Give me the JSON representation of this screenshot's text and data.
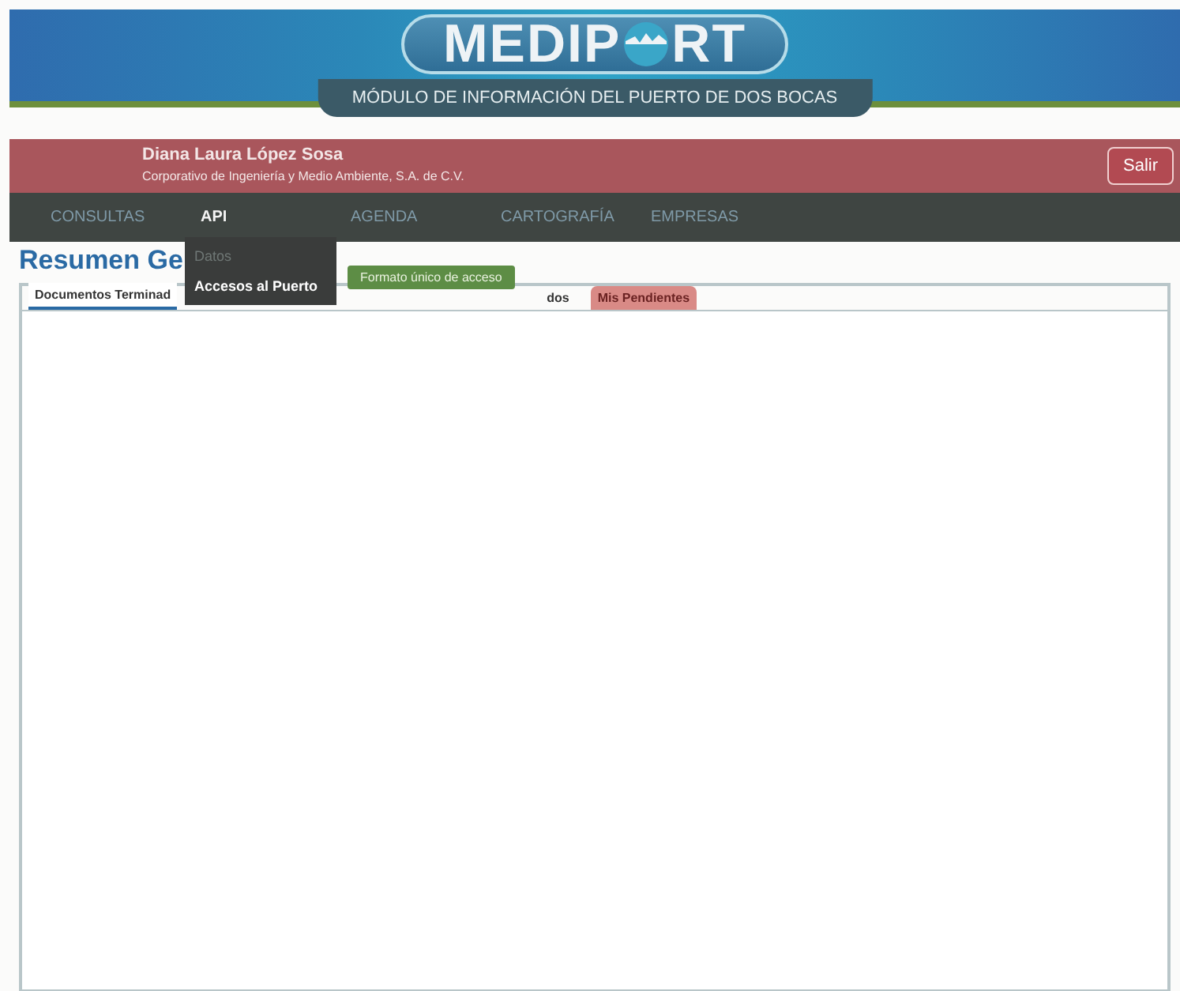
{
  "header": {
    "logo_left": "MEDIP",
    "logo_right": "RT",
    "subtitle": "MÓDULO DE INFORMACIÓN DEL PUERTO DE DOS BOCAS"
  },
  "user_bar": {
    "name": "Diana Laura López Sosa",
    "company": "Corporativo de Ingeniería y Medio Ambiente, S.A. de C.V.",
    "logout": "Salir"
  },
  "nav": [
    {
      "label": "CONSULTAS",
      "selected": false
    },
    {
      "label": "API",
      "selected": true
    },
    {
      "label": "AGENDA",
      "selected": false
    },
    {
      "label": "CARTOGRAFÍA",
      "selected": false
    },
    {
      "label": "EMPRESAS",
      "selected": false
    }
  ],
  "dropdown": {
    "items": [
      {
        "label": "Datos",
        "selected": false
      },
      {
        "label": "Accesos al Puerto",
        "selected": true
      }
    ],
    "submenu": [
      "Formato único de acceso"
    ]
  },
  "page_title": "Resumen Ge",
  "tabs": [
    {
      "label": "Documentos Terminad",
      "kind": "normal",
      "selected": true
    },
    {
      "label": "dos",
      "kind": "normal",
      "selected": false
    },
    {
      "label": "Mis Pendientes",
      "kind": "alert",
      "selected": false
    }
  ]
}
